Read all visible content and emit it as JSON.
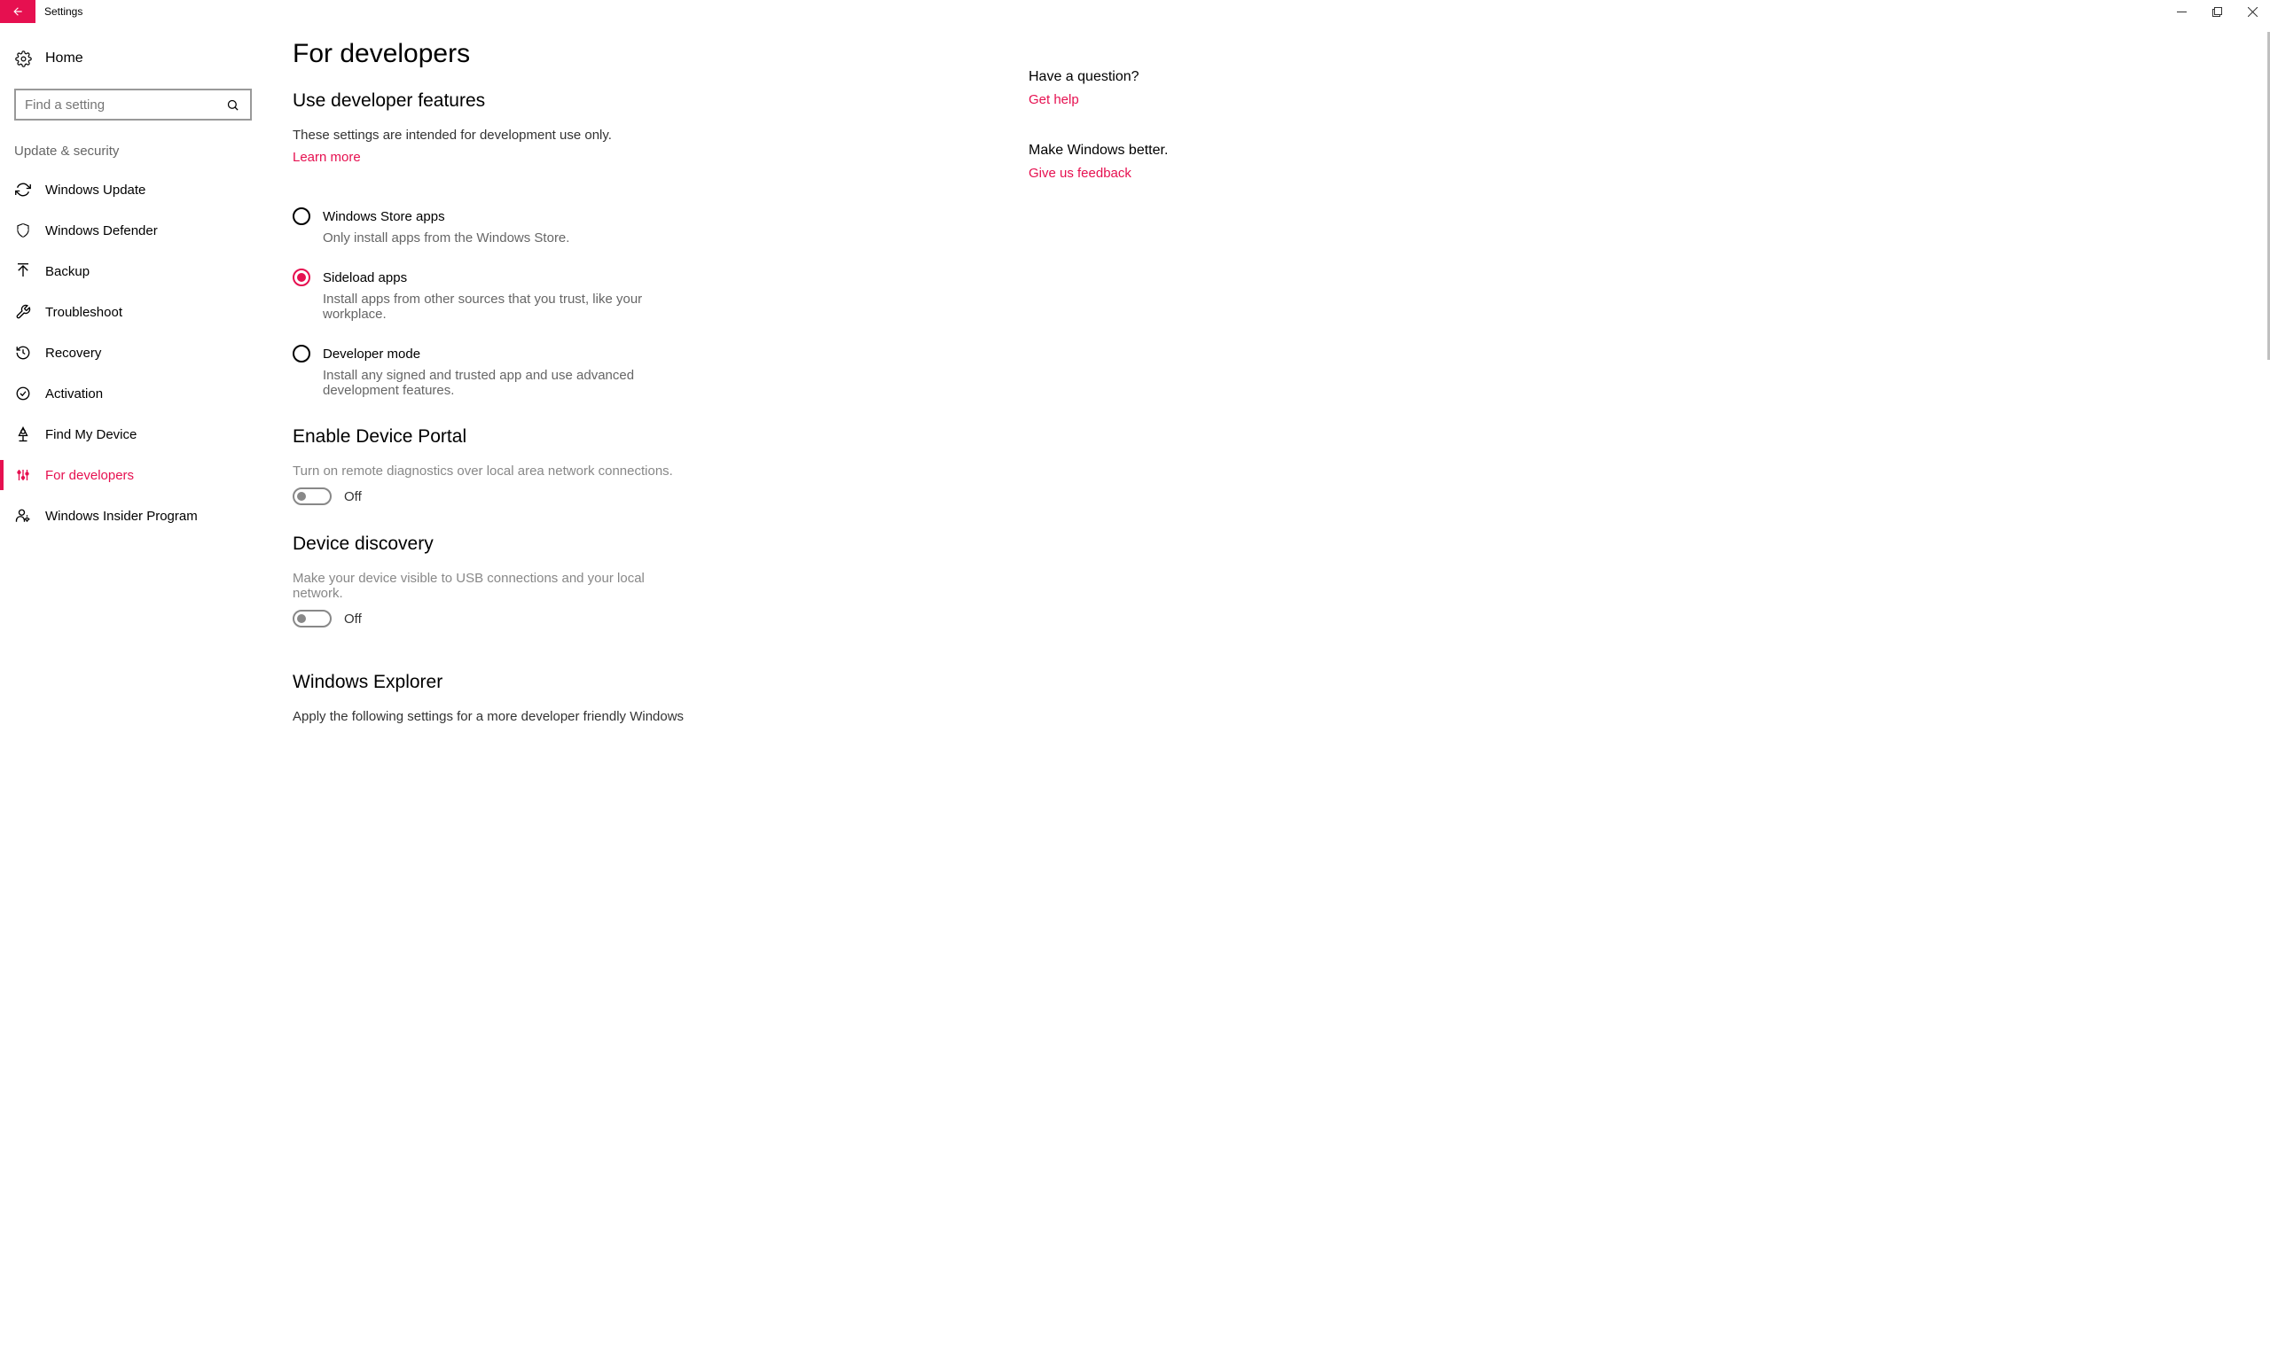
{
  "window": {
    "title": "Settings"
  },
  "sidebar": {
    "home_label": "Home",
    "search_placeholder": "Find a setting",
    "category_label": "Update & security",
    "items": [
      {
        "label": "Windows Update",
        "icon": "refresh",
        "active": false
      },
      {
        "label": "Windows Defender",
        "icon": "shield",
        "active": false
      },
      {
        "label": "Backup",
        "icon": "upload",
        "active": false
      },
      {
        "label": "Troubleshoot",
        "icon": "wrench",
        "active": false
      },
      {
        "label": "Recovery",
        "icon": "history",
        "active": false
      },
      {
        "label": "Activation",
        "icon": "check-circle",
        "active": false
      },
      {
        "label": "Find My Device",
        "icon": "locate",
        "active": false
      },
      {
        "label": "For developers",
        "icon": "dev",
        "active": true
      },
      {
        "label": "Windows Insider Program",
        "icon": "insider",
        "active": false
      }
    ]
  },
  "main": {
    "page_title": "For developers",
    "sections": {
      "dev_features": {
        "title": "Use developer features",
        "desc": "These settings are intended for development use only.",
        "learn_more": "Learn more",
        "options": [
          {
            "label": "Windows Store apps",
            "desc": "Only install apps from the Windows Store.",
            "selected": false
          },
          {
            "label": "Sideload apps",
            "desc": "Install apps from other sources that you trust, like your workplace.",
            "selected": true
          },
          {
            "label": "Developer mode",
            "desc": "Install any signed and trusted app and use advanced development features.",
            "selected": false
          }
        ]
      },
      "device_portal": {
        "title": "Enable Device Portal",
        "desc": "Turn on remote diagnostics over local area network connections.",
        "toggle_state": "Off"
      },
      "device_discovery": {
        "title": "Device discovery",
        "desc": "Make your device visible to USB connections and your local network.",
        "toggle_state": "Off"
      },
      "windows_explorer": {
        "title": "Windows Explorer",
        "desc": "Apply the following settings for a more developer friendly Windows"
      }
    }
  },
  "right_panel": {
    "question_title": "Have a question?",
    "help_link": "Get help",
    "feedback_title": "Make Windows better.",
    "feedback_link": "Give us feedback"
  }
}
